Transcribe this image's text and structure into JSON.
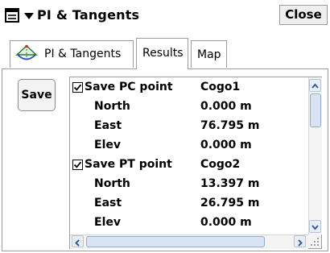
{
  "window": {
    "title": "PI & Tangents",
    "close_label": "Close",
    "menu_icon": "menu-icon"
  },
  "tabs": [
    {
      "label": "PI & Tangents",
      "icon": "pi-tangents-icon",
      "selected": false
    },
    {
      "label": "Results",
      "selected": true
    },
    {
      "label": "Map",
      "selected": false
    }
  ],
  "save_label": "Save",
  "rows": [
    {
      "name": "Save PC point",
      "value": "Cogo1",
      "checkbox": true,
      "checked": true
    },
    {
      "name": "North",
      "value": "0.000 m"
    },
    {
      "name": "East",
      "value": "76.795 m"
    },
    {
      "name": "Elev",
      "value": "0.000 m"
    },
    {
      "name": "Save PT point",
      "value": "Cogo2",
      "checkbox": true,
      "checked": true
    },
    {
      "name": "North",
      "value": "13.397 m"
    },
    {
      "name": "East",
      "value": "26.795 m"
    },
    {
      "name": "Elev",
      "value": "0.000 m"
    }
  ],
  "colors": {
    "scrollbar_thumb": "#d8e4f4",
    "scrollbar_border": "#96abce",
    "scroll_arrow": "#3a5a9a"
  }
}
